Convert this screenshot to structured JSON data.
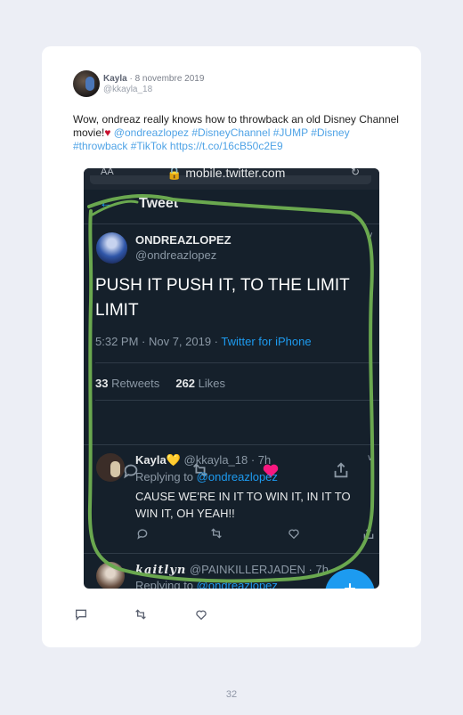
{
  "tweet": {
    "author_name": "Kayla",
    "date": " · 8 novembre 2019",
    "handle": "@kkayla_18",
    "text_plain": "Wow, ondreaz really knows how to throwback an old Disney Channel movie!",
    "heart_emoji": "♥",
    "text_links": " @ondreazlopez #DisneyChannel #JUMP #Disney #throwback #TikTok https://t.co/16cB50c2E9"
  },
  "screenshot": {
    "browser": {
      "aa_label": "AA",
      "url": "🔒 mobile.twitter.com",
      "reload_glyph": "↻"
    },
    "header": {
      "back_glyph": "←",
      "title": "Tweet"
    },
    "post": {
      "name": "ONDREAZLOPEZ",
      "handle": "@ondreazlopez",
      "text": "PUSH IT PUSH IT, TO THE LIMIT LIMIT",
      "timestamp": "5:32 PM · Nov 7, 2019 · ",
      "source": "Twitter for iPhone",
      "retweets_count": "33",
      "retweets_label": " Retweets",
      "likes_count": "262",
      "likes_label": " Likes",
      "chevron": "∨"
    },
    "reply1": {
      "name": "Kayla💛",
      "meta": " @kkayla_18 · 7h",
      "replying_prefix": "Replying to ",
      "replying_handle": "@ondreazlopez",
      "text": "CAUSE WE'RE IN IT TO WIN IT, IN IT TO WIN IT, OH YEAH!!",
      "chevron": "∨"
    },
    "reply2": {
      "name": "kaitlyn",
      "meta": " @PAINKILLERJADEN · 7h",
      "replying_prefix": "Replying to ",
      "replying_handle": "@ondreazlopez"
    },
    "colors": {
      "background": "#15202b",
      "accent": "#1d9bf0",
      "like_active": "#f91880",
      "annotation": "#6aa84f"
    }
  },
  "icons": [
    "reply-icon",
    "retweet-icon",
    "like-icon",
    "share-icon",
    "compose-icon",
    "lock-icon"
  ],
  "page_number": "32"
}
